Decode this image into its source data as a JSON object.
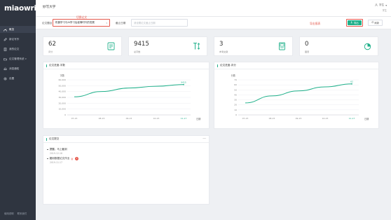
{
  "app": {
    "logo": "miaowrite",
    "site_title": "妙写大学"
  },
  "user": {
    "name": "学生",
    "role": "学生"
  },
  "sidebar": {
    "items": [
      {
        "label": "概览",
        "icon": "dashboard-icon",
        "active": true
      },
      {
        "label": "新论写作",
        "icon": "edit-icon"
      },
      {
        "label": "我的论文",
        "icon": "document-icon"
      },
      {
        "label": "论文管理系统",
        "icon": "folder-icon",
        "has_caret": true
      },
      {
        "label": "消息通知",
        "icon": "bell-icon"
      },
      {
        "label": "设置",
        "icon": "gear-icon"
      }
    ],
    "footer": [
      "使用说明",
      "联系我们"
    ]
  },
  "filter": {
    "paper_label": "论文题目",
    "paper_value": "机器学习与AI学习后疫情时代的发展",
    "switch_annotation": "切换论文",
    "date_label": "截止日期",
    "date_placeholder": "请设置论文截止日期",
    "export_annotation": "导出报表",
    "export_label": "导出",
    "refresh_label": "刷新"
  },
  "stats": [
    {
      "value": "62",
      "label": "评分",
      "icon": "checklist-icon"
    },
    {
      "value": "9415",
      "label": "总字数",
      "icon": "text-size-icon"
    },
    {
      "value": "3",
      "label": "参考文献",
      "icon": "book-icon"
    },
    {
      "value": "0",
      "label": "图表",
      "icon": "pie-chart-icon"
    }
  ],
  "colors": {
    "accent": "#1fb08a",
    "annotation": "#e55a4e",
    "sidebar": "#2f3540"
  },
  "chart_data": [
    {
      "type": "line",
      "title": "论文进度-字数",
      "ylabel": "字数",
      "xlabel": "日期",
      "categories": [
        "07-15",
        "08-15",
        "09-15",
        "10-15",
        "11-17"
      ],
      "x_highlight": "11-17",
      "y_ticks": [
        "0",
        "10,000",
        "20,000",
        "30,000",
        "40,000",
        "50,000",
        "60,000"
      ],
      "ylim": [
        0,
        60000
      ],
      "series": [
        {
          "values": [
            31000,
            40000,
            46000,
            49000,
            52000
          ]
        }
      ],
      "end_label": "9415",
      "grid": true
    },
    {
      "type": "line",
      "title": "论文进度-评分",
      "ylabel": "分数",
      "xlabel": "日期",
      "categories": [
        "07-15",
        "08-15",
        "09-15",
        "10-15",
        "11-17"
      ],
      "x_highlight": "11-17",
      "y_ticks": [
        "0",
        "10",
        "20",
        "30",
        "40",
        "50",
        "60",
        "70"
      ],
      "ylim": [
        0,
        70
      ],
      "series": [
        {
          "values": [
            24,
            38,
            48,
            56,
            62
          ]
        }
      ],
      "end_label": "62",
      "grid": true
    }
  ],
  "notices": {
    "title": "论文提交",
    "menu": "···",
    "items": [
      {
        "text": "提醒。马上截到",
        "date": "2019-12-16"
      },
      {
        "text": "搬用数据论文作业",
        "date": "2019-11-17",
        "badge": "1",
        "new_mark": "新"
      }
    ]
  }
}
